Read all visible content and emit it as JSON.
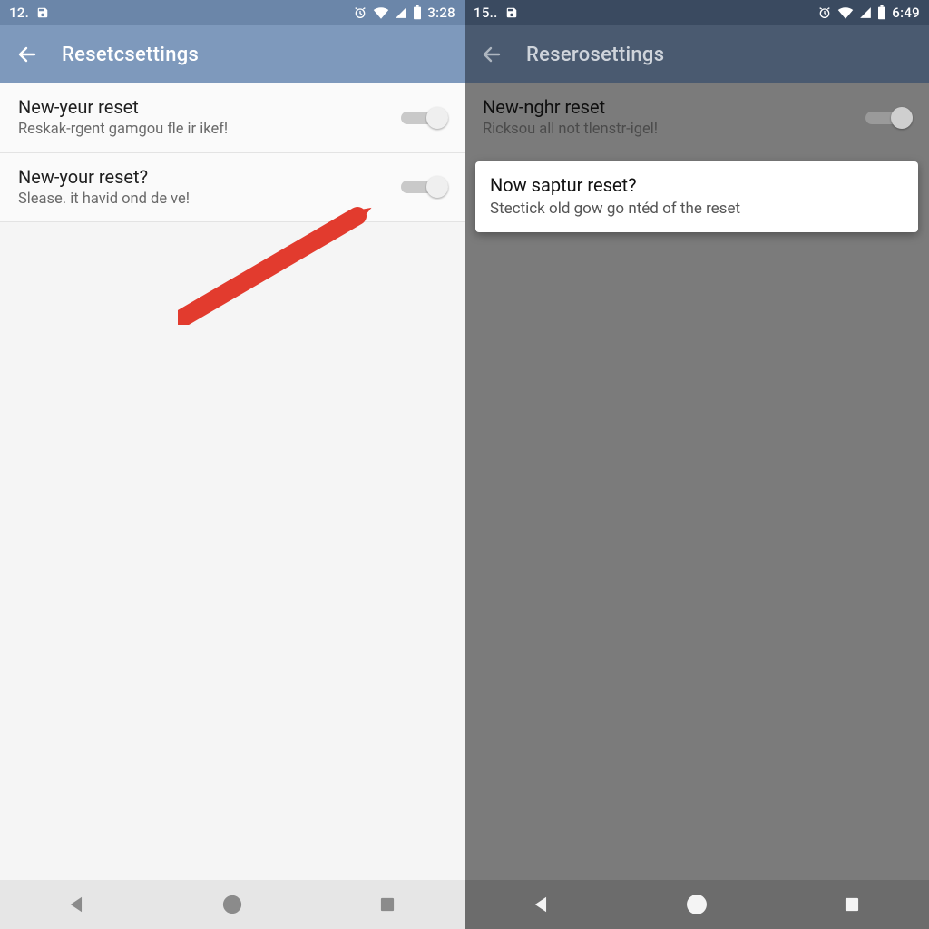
{
  "left": {
    "status": {
      "left_text": "12.",
      "time": "3:28"
    },
    "appbar": {
      "title": "Resetcsettings"
    },
    "rows": [
      {
        "title": "New-yeur reset",
        "sub": "Reskak-rgent gamgou fle ir ikef!"
      },
      {
        "title": "New-your reset?",
        "sub": "Slease. it havid ond de    ve!"
      }
    ]
  },
  "right": {
    "status": {
      "left_text": "15..",
      "time": "6:49"
    },
    "appbar": {
      "title": "Reserosettings"
    },
    "row": {
      "title": "New-nghr reset",
      "sub": "Ricksou all not tlenstr-igel!"
    },
    "dialog": {
      "title": "Now saptur reset?",
      "sub": "Stectick old gow go ntéd of the reset"
    }
  },
  "icons": {
    "save": "save-icon",
    "alarm": "alarm-icon",
    "wifi": "wifi-icon",
    "cell": "cell-signal-icon",
    "battery": "battery-icon",
    "back": "back-arrow-icon",
    "nav_back": "nav-back-icon",
    "nav_home": "nav-home-icon",
    "nav_recent": "nav-recent-icon"
  },
  "colors": {
    "left_appbar": "#7e99bc",
    "right_appbar": "#4a5a70",
    "arrow": "#e23b2e"
  }
}
